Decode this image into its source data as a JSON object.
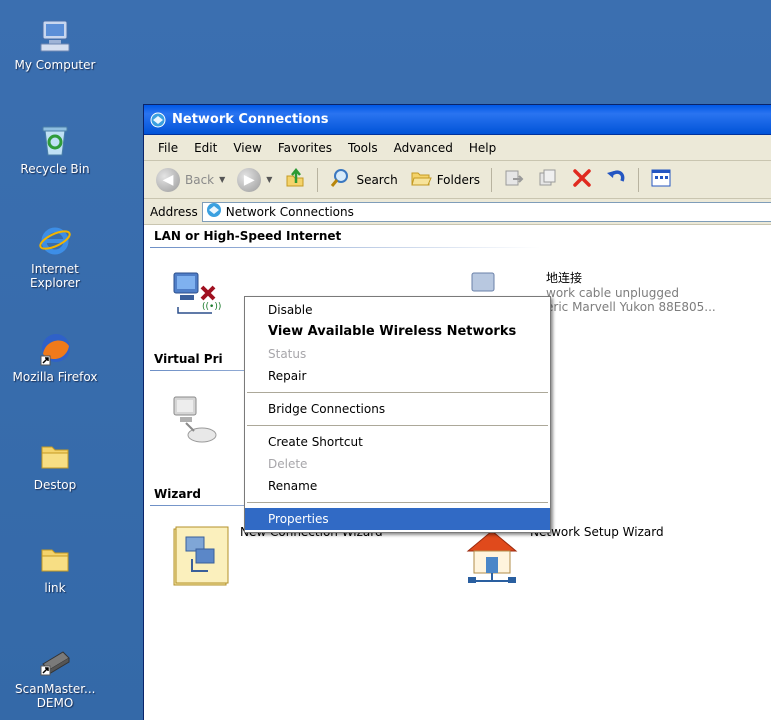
{
  "desktop": {
    "icons": [
      {
        "label": "My Computer",
        "icon": "my-computer-icon"
      },
      {
        "label": "Recycle Bin",
        "icon": "recycle-bin-icon"
      },
      {
        "label": "Internet Explorer",
        "icon": "internet-explorer-icon"
      },
      {
        "label": "Mozilla Firefox",
        "icon": "firefox-icon"
      },
      {
        "label": "Destop",
        "icon": "folder-icon"
      },
      {
        "label": "link",
        "icon": "folder-icon"
      },
      {
        "label": "ScanMaster... DEMO",
        "icon": "scanmaster-icon"
      }
    ]
  },
  "window": {
    "title": "Network Connections",
    "menu": [
      "File",
      "Edit",
      "View",
      "Favorites",
      "Tools",
      "Advanced",
      "Help"
    ],
    "toolbar": {
      "back_label": "Back",
      "search_label": "Search",
      "folders_label": "Folders"
    },
    "address": {
      "label": "Address",
      "value": "Network Connections"
    },
    "sections": {
      "lan": "LAN or High-Speed Internet",
      "vpn": "Virtual Pri",
      "wizard": "Wizard"
    },
    "items": {
      "local_conn_name": "地连接",
      "local_conn_status": "work cable unplugged",
      "local_conn_device": "eric Marvell Yukon 88E805...",
      "new_connection_wizard": "New Connection Wizard",
      "network_setup_wizard": "Network Setup Wizard"
    }
  },
  "context_menu": {
    "items": [
      {
        "label": "Disable",
        "state": "normal"
      },
      {
        "label": "View Available Wireless Networks",
        "state": "bold"
      },
      {
        "label": "Status",
        "state": "disabled"
      },
      {
        "label": "Repair",
        "state": "normal"
      },
      {
        "label": "Bridge Connections",
        "state": "normal"
      },
      {
        "label": "Create Shortcut",
        "state": "normal"
      },
      {
        "label": "Delete",
        "state": "disabled"
      },
      {
        "label": "Rename",
        "state": "normal"
      },
      {
        "label": "Properties",
        "state": "selected"
      }
    ]
  },
  "colors": {
    "desktop": "#3a6ea5",
    "titlebar": "#0058e6",
    "selection": "#316ac5"
  }
}
